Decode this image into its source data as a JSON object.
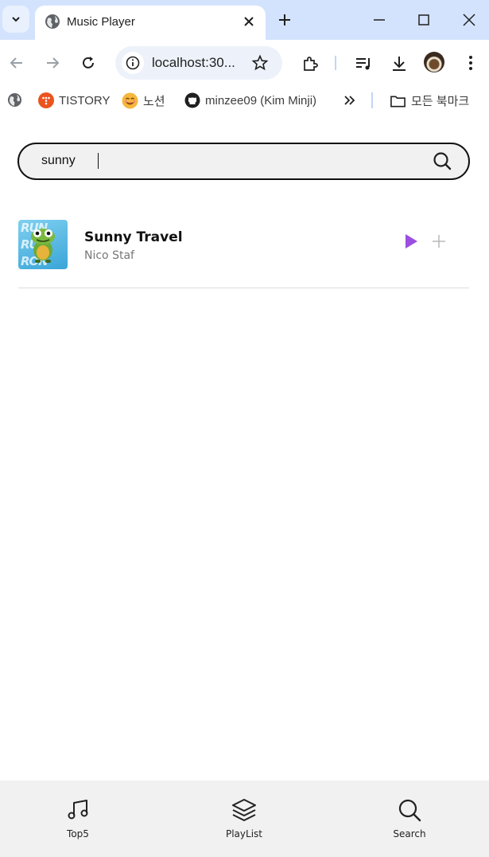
{
  "browser": {
    "tab_title": "Music Player",
    "url": "localhost:30...",
    "bookmarks": [
      {
        "label": "",
        "icon": "globe-icon"
      },
      {
        "label": "TISTORY",
        "icon": "tistory-icon"
      },
      {
        "label": "노션",
        "icon": "smiley-icon"
      },
      {
        "label": "minzee09 (Kim Minji)",
        "icon": "github-icon"
      },
      {
        "label": "모든 북마크",
        "icon": "folder-icon"
      }
    ]
  },
  "search": {
    "value": "sunny",
    "icon": "search-icon"
  },
  "results": [
    {
      "title": "Sunny Travel",
      "artist": "Nico Staf",
      "cover_text": [
        "RUN",
        "RUN",
        "RON"
      ],
      "play_icon": "play-icon",
      "add_icon": "plus-icon"
    }
  ],
  "nav": {
    "items": [
      {
        "label": "Top5",
        "icon": "music-note-icon"
      },
      {
        "label": "PlayList",
        "icon": "layers-icon"
      },
      {
        "label": "Search",
        "icon": "search-icon"
      }
    ]
  },
  "colors": {
    "accent_play": "#9b4fe0",
    "tabstrip": "#d3e3fd",
    "nav_bg": "#f1f1f1"
  }
}
